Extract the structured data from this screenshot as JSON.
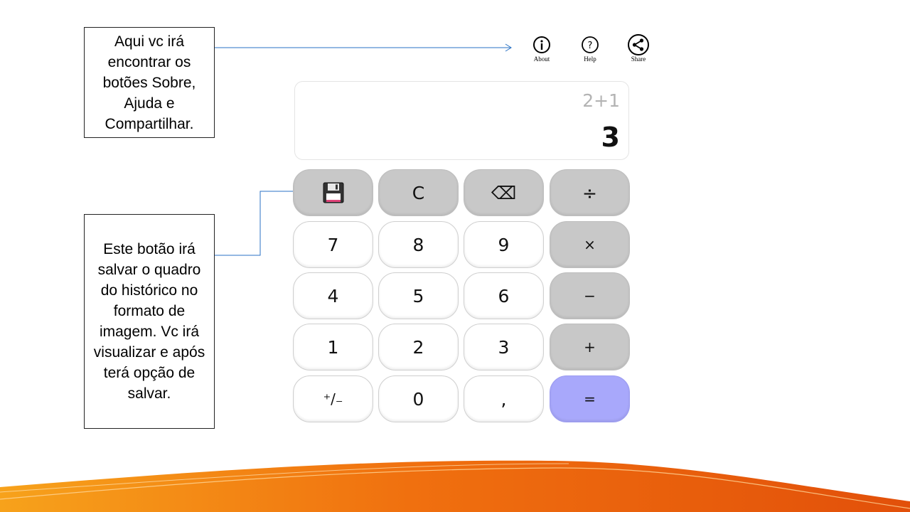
{
  "callouts": {
    "top": "Aqui vc irá encontrar os botões Sobre, Ajuda e Compartilhar.",
    "bottom": "Este botão irá salvar o quadro do histórico no formato de imagem. Vc irá visualizar e após terá opção de salvar."
  },
  "toolbar": {
    "about_label": "About",
    "help_label": "Help",
    "share_label": "Share"
  },
  "display": {
    "expression": "2+1",
    "result": "3"
  },
  "keypad": {
    "clear": "C",
    "backspace": "⌫",
    "divide": "÷",
    "multiply": "×",
    "subtract": "−",
    "add": "+",
    "equals": "=",
    "plusminus": "⁺/₋",
    "decimal": ",",
    "d0": "0",
    "d1": "1",
    "d2": "2",
    "d3": "3",
    "d4": "4",
    "d5": "5",
    "d6": "6",
    "d7": "7",
    "d8": "8",
    "d9": "9"
  },
  "colors": {
    "operator_key": "#c8c8c8",
    "equals_key": "#a8a8fb",
    "arrow": "#2a72c4",
    "wave_orange": "#f06a10"
  },
  "icons": {
    "save": "floppy-disk-icon",
    "about": "info-icon",
    "help": "help-icon",
    "share": "share-icon"
  }
}
